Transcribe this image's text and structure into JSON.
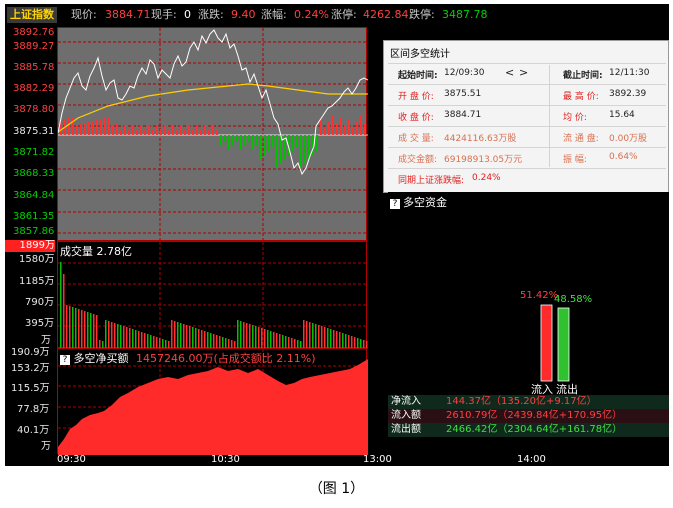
{
  "header": {
    "index_name": "上证指数",
    "price_label": "现价:",
    "price_value": "3884.71",
    "hand_label": "现手:",
    "hand_value": "0",
    "change_label": "涨跌:",
    "change_value": "9.40",
    "pct_label": "涨幅:",
    "pct_value": "0.24%",
    "limit_up_label": "涨停:",
    "limit_up_value": "4262.84",
    "limit_down_label": "跌停:",
    "limit_down_value": "3487.78"
  },
  "price_axis": [
    "3892.76",
    "3889.27",
    "3885.78",
    "3882.29",
    "3878.80",
    "3875.31",
    "3871.82",
    "3868.33",
    "3864.84",
    "3861.35",
    "3857.86"
  ],
  "volume_axis": {
    "max_label": "1899万",
    "ticks": [
      "1580万",
      "1185万",
      "790万",
      "395万",
      "万"
    ],
    "caption": "成交量 2.78亿"
  },
  "net_axis": {
    "ticks": [
      "190.9万",
      "153.2万",
      "115.5万",
      "77.8万",
      "40.1万",
      "万"
    ],
    "caption_name": "多空净买额",
    "caption_value": "1457246.00万(占成交额比 2.11%)"
  },
  "x_axis": [
    "09:30",
    "10:30",
    "13:00",
    "14:00"
  ],
  "stats_dialog": {
    "title": "区间多空统计",
    "start_label": "起始时间:",
    "start_value": "12/09:30",
    "nav_prev": "<",
    "nav_next": ">",
    "end_label": "截止时间:",
    "end_value": "12/11:30",
    "open_label": "开 盘 价:",
    "open_value": "3875.51",
    "high_label": "最 高 价:",
    "high_value": "3892.39",
    "close_label": "收 盘 价:",
    "close_value": "3884.71",
    "avg_label": "均    价:",
    "avg_value": "15.64",
    "vol_label": "成 交 量:",
    "vol_value": "4424116.63万股",
    "float_label": "流 通 盘:",
    "float_value": "0.00万股",
    "amount_label": "成交金额:",
    "amount_value": "69198913.05万元",
    "amp_label": "振     幅:",
    "amp_value": "0.64%",
    "same_label": "同期上证涨跌幅:",
    "same_value": "0.24%"
  },
  "money_flow": {
    "title": "多空资金",
    "inflow_pct": "51.42%",
    "outflow_pct": "48.58%",
    "inflow_bar_label": "流入",
    "outflow_bar_label": "流出",
    "rows": [
      {
        "name": "净流入",
        "value": "144.37亿（135.20亿+9.17亿）"
      },
      {
        "name": "流入额",
        "value": "2610.79亿（2439.84亿+170.95亿）"
      },
      {
        "name": "流出额",
        "value": "2466.42亿（2304.64亿+161.78亿）"
      }
    ]
  },
  "figure_caption": "（图 1）",
  "colors": {
    "up": "#ff3030",
    "down": "#00c000",
    "price_line": "#ffffff",
    "avg_line": "#ffd000",
    "grid": "#b00000",
    "title_yellow": "#ffd400"
  }
}
